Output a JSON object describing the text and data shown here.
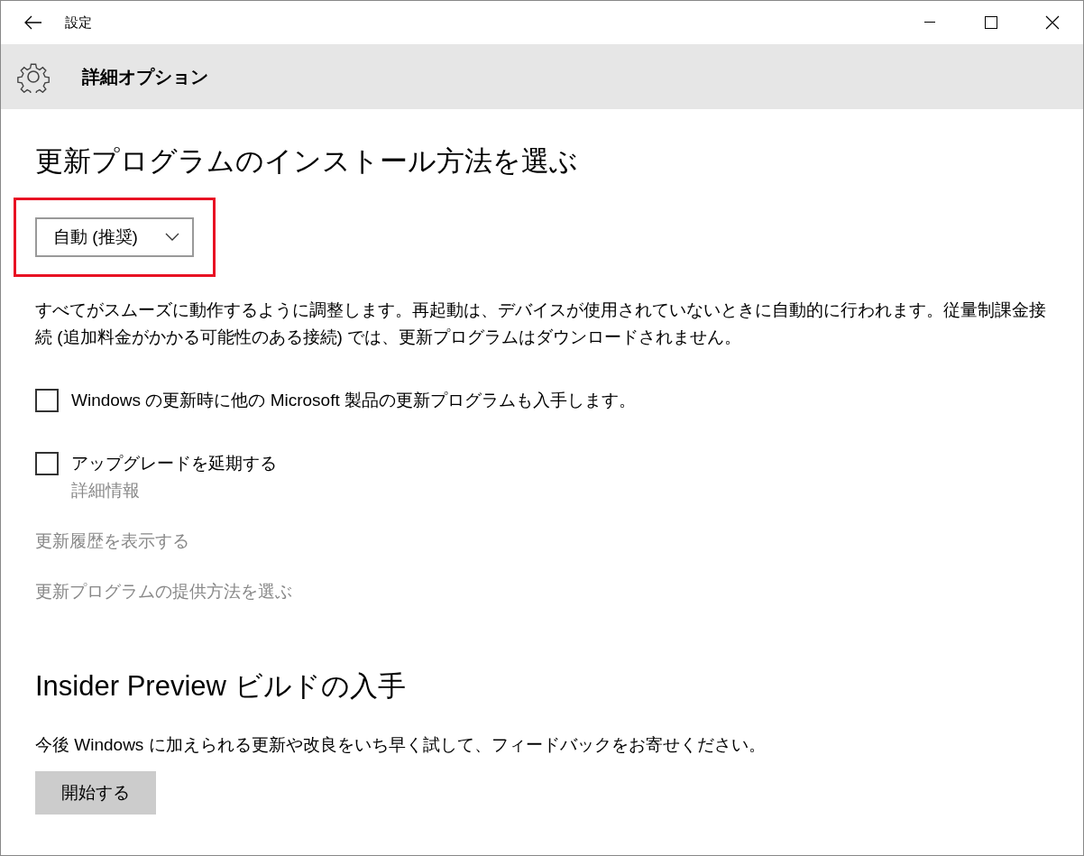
{
  "window": {
    "title": "設定"
  },
  "header": {
    "title": "詳細オプション"
  },
  "install_section": {
    "heading": "更新プログラムのインストール方法を選ぶ",
    "dropdown": {
      "value": "自動 (推奨)",
      "highlighted": true
    },
    "description": "すべてがスムーズに動作するように調整します。再起動は、デバイスが使用されていないときに自動的に行われます。従量制課金接続 (追加料金がかかる可能性のある接続) では、更新プログラムはダウンロードされません。",
    "options": [
      {
        "label": "Windows の更新時に他の Microsoft 製品の更新プログラムも入手します。",
        "checked": false
      },
      {
        "label": "アップグレードを延期する",
        "checked": false,
        "link": "詳細情報"
      }
    ],
    "links": [
      "更新履歴を表示する",
      "更新プログラムの提供方法を選ぶ"
    ]
  },
  "insider_section": {
    "heading": "Insider Preview ビルドの入手",
    "description": "今後 Windows に加えられる更新や改良をいち早く試して、フィードバックをお寄せください。",
    "button": "開始する"
  }
}
